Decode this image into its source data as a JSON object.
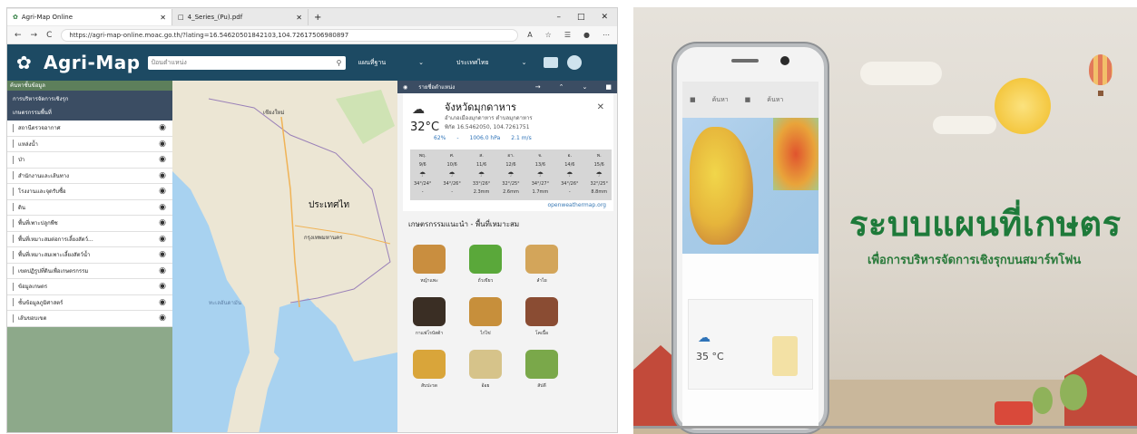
{
  "browser": {
    "tabs": [
      {
        "label": "Agri-Map Online",
        "active": true
      },
      {
        "label": "4_Series_(Pu).pdf",
        "active": false
      }
    ],
    "new_tab": "+",
    "window_controls": [
      "–",
      "□",
      "✕"
    ],
    "url": "https://agri-map-online.moac.go.th/?lating=16.54620501842103,104.72617506980897",
    "nav": {
      "back": "←",
      "forward": "→",
      "reload": "C"
    }
  },
  "app": {
    "logo_text": "Agri-Map",
    "search_placeholder": "ป้อนตำแหน่ง",
    "basemap_select": "แผนที่ฐาน",
    "country_select": "ประเทศไทย"
  },
  "sidebar": {
    "search_placeholder": "ค้นหาชั้นข้อมูล",
    "header_lines": [
      "การบริหารจัดการเชิงรุก",
      "เกษตรกรรมพื้นที่"
    ],
    "items": [
      "สถานีตรวจอากาศ",
      "แหล่งน้ำ",
      "ป่า",
      "สำนักงานและเส้นทาง",
      "โรงงานและจุดรับซื้อ",
      "ดิน",
      "พื้นที่เพาะปลูกพืช",
      "พื้นที่เหมาะสมต่อการเลี้ยงสัตว์...",
      "พื้นที่เหมาะสมเพาะเลี้ยงสัตว์น้ำ",
      "เขตปฏิรูปที่ดินเพื่อเกษตรกรรม",
      "ข้อมูลเกษตร",
      "ชั้นข้อมูลภูมิศาสตร์",
      "เส้นขอบเขต"
    ]
  },
  "map": {
    "country_label": "ประเทศไท",
    "capital_label": "กรุงเทพมหานคร",
    "sea_label": "ทะเลอันดามัน",
    "top_label": "เชียงใหม่"
  },
  "panel": {
    "header": "รายชื่อตำแหน่ง",
    "weather": {
      "province": "จังหวัดมุกดาหาร",
      "district": "อำเภอเมืองมุกดาหาร ตำบลมุกดาหาร",
      "coords": "พิกัด 16.5462050, 104.7261751",
      "temperature": "32°C",
      "stats": [
        "62%",
        "-",
        "1006.0 hPa",
        "2.1 m/s"
      ],
      "forecast": [
        {
          "day": "พฤ.",
          "date": "9/6",
          "range": "34°/24°",
          "rain": "-"
        },
        {
          "day": "ศ.",
          "date": "10/6",
          "range": "34°/26°",
          "rain": "-"
        },
        {
          "day": "ส.",
          "date": "11/6",
          "range": "33°/26°",
          "rain": "2.3mm"
        },
        {
          "day": "อา.",
          "date": "12/6",
          "range": "32°/25°",
          "rain": "2.6mm"
        },
        {
          "day": "จ.",
          "date": "13/6",
          "range": "34°/27°",
          "rain": "1.7mm"
        },
        {
          "day": "อ.",
          "date": "14/6",
          "range": "34°/26°",
          "rain": "-"
        },
        {
          "day": "พ.",
          "date": "15/6",
          "range": "32°/25°",
          "rain": "8.8mm"
        }
      ],
      "source": "openweathermap.org"
    },
    "crops_title": "เกษตรกรรมแนะนำ - พื้นที่เหมาะสม",
    "crops": [
      {
        "name": "หญ้าแพะ",
        "color": "#c98e3f"
      },
      {
        "name": "ถั่วเขียว",
        "color": "#5aa83a"
      },
      {
        "name": "ลำไย",
        "color": "#d3a55a"
      },
      {
        "name": "กาแฟโรบัสต้า",
        "color": "#3a2e24"
      },
      {
        "name": "ไก่ไข่",
        "color": "#c78f3b"
      },
      {
        "name": "โคเนื้อ",
        "color": "#8a4c33"
      },
      {
        "name": "สับปะรด",
        "color": "#d9a53a"
      },
      {
        "name": "อ้อย",
        "color": "#d6c38a"
      },
      {
        "name": "สัปดี",
        "color": "#7aa84a"
      }
    ]
  },
  "video": {
    "title": "ระบบแผนที่เกษตร",
    "subtitle": "เพื่อการบริหารจัดการเชิงรุกบนสมาร์ทโฟน",
    "phone": {
      "tab1": "ค้นหา",
      "tab2": "ค้นหา",
      "temperature": "35 °C"
    }
  },
  "colors": {
    "header_blue": "#1d4a63",
    "panel_navy": "#3b4d63",
    "title_green": "#1e7a3a"
  }
}
